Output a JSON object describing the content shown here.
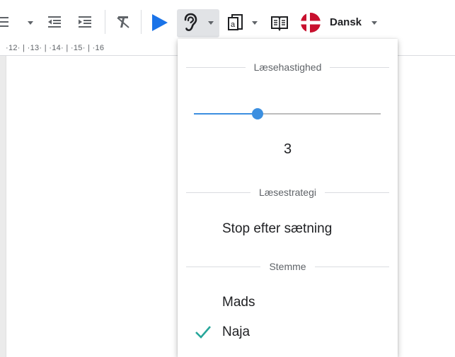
{
  "toolbar": {
    "icons": [
      "list-icon",
      "decrease-indent-icon",
      "increase-indent-icon",
      "clear-formatting-icon",
      "play-icon",
      "ear-icon",
      "overlay-icon",
      "dictionary-icon",
      "flag-denmark-icon"
    ],
    "language_label": "Dansk",
    "play_color": "#1a73e8",
    "flag_color": "#c8102e"
  },
  "ruler": {
    "text": "·12·  | ·13·  | ·14·  | ·15·  |  ·16"
  },
  "dropdown": {
    "reading_speed": {
      "label": "Læsehastighed",
      "value": "3",
      "level_fraction": 0.34,
      "accent_color": "#3c8fe0"
    },
    "reading_strategy": {
      "label": "Læsestrategi",
      "selected": "Stop efter sætning"
    },
    "voice": {
      "label": "Stemme",
      "options": [
        {
          "name": "Mads",
          "selected": false
        },
        {
          "name": "Naja",
          "selected": true
        }
      ],
      "check_color": "#26a69a"
    }
  }
}
